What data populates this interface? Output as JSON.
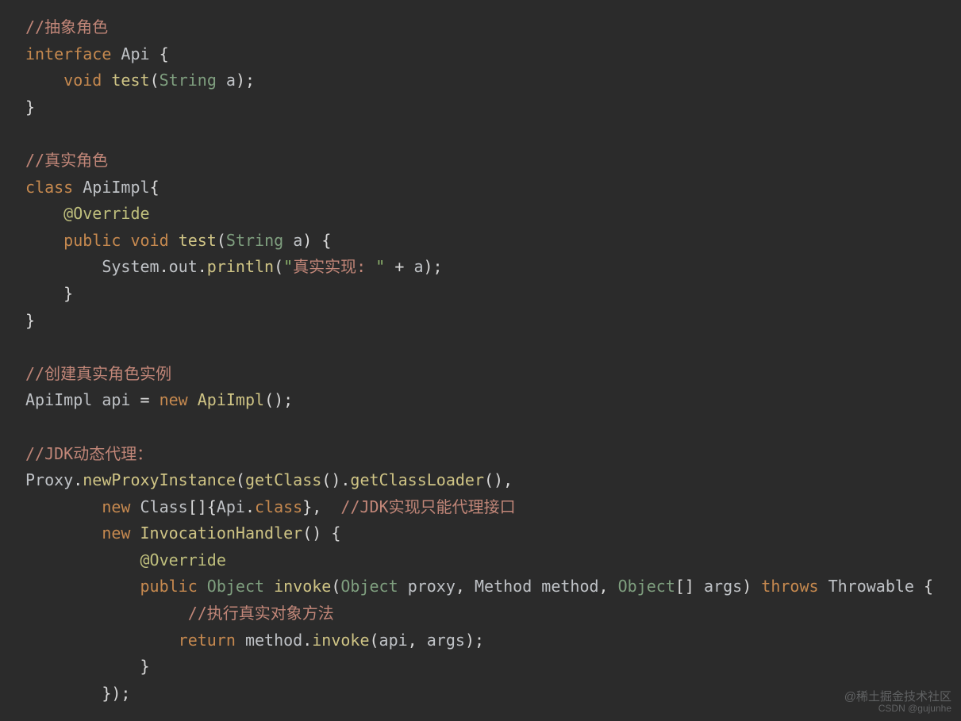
{
  "lines": [
    {
      "id": "l01",
      "tokens": [
        {
          "cls": "c-cn",
          "t": "//抽象角色"
        }
      ]
    },
    {
      "id": "l02",
      "tokens": [
        {
          "cls": "c-keyword",
          "t": "interface"
        },
        {
          "cls": "",
          "t": " "
        },
        {
          "cls": "c-ident",
          "t": "Api "
        },
        {
          "cls": "c-punct",
          "t": "{"
        }
      ]
    },
    {
      "id": "l03",
      "tokens": [
        {
          "cls": "",
          "t": "    "
        },
        {
          "cls": "c-keyword",
          "t": "void"
        },
        {
          "cls": "",
          "t": " "
        },
        {
          "cls": "c-method",
          "t": "test"
        },
        {
          "cls": "c-punct",
          "t": "("
        },
        {
          "cls": "c-type",
          "t": "String"
        },
        {
          "cls": "",
          "t": " "
        },
        {
          "cls": "c-ident",
          "t": "a"
        },
        {
          "cls": "c-punct",
          "t": ");"
        }
      ]
    },
    {
      "id": "l04",
      "tokens": [
        {
          "cls": "c-punct",
          "t": "}"
        }
      ]
    },
    {
      "id": "l05",
      "tokens": [
        {
          "cls": "",
          "t": ""
        }
      ]
    },
    {
      "id": "l06",
      "tokens": [
        {
          "cls": "c-cn",
          "t": "//真实角色"
        }
      ]
    },
    {
      "id": "l07",
      "tokens": [
        {
          "cls": "c-keyword",
          "t": "class"
        },
        {
          "cls": "",
          "t": " "
        },
        {
          "cls": "c-ident",
          "t": "ApiImpl"
        },
        {
          "cls": "c-punct",
          "t": "{"
        }
      ]
    },
    {
      "id": "l08",
      "tokens": [
        {
          "cls": "",
          "t": "    "
        },
        {
          "cls": "c-annot",
          "t": "@Override"
        }
      ]
    },
    {
      "id": "l09",
      "tokens": [
        {
          "cls": "",
          "t": "    "
        },
        {
          "cls": "c-keyword",
          "t": "public"
        },
        {
          "cls": "",
          "t": " "
        },
        {
          "cls": "c-keyword",
          "t": "void"
        },
        {
          "cls": "",
          "t": " "
        },
        {
          "cls": "c-method",
          "t": "test"
        },
        {
          "cls": "c-punct",
          "t": "("
        },
        {
          "cls": "c-type",
          "t": "String"
        },
        {
          "cls": "",
          "t": " "
        },
        {
          "cls": "c-ident",
          "t": "a"
        },
        {
          "cls": "c-punct",
          "t": ") {"
        }
      ]
    },
    {
      "id": "l10",
      "tokens": [
        {
          "cls": "",
          "t": "        "
        },
        {
          "cls": "c-ident",
          "t": "System"
        },
        {
          "cls": "c-punct",
          "t": "."
        },
        {
          "cls": "c-ident",
          "t": "out"
        },
        {
          "cls": "c-punct",
          "t": "."
        },
        {
          "cls": "c-method",
          "t": "println"
        },
        {
          "cls": "c-punct",
          "t": "("
        },
        {
          "cls": "c-string",
          "t": "\""
        },
        {
          "cls": "c-string-cn",
          "t": "真实实现: "
        },
        {
          "cls": "c-string",
          "t": "\""
        },
        {
          "cls": "",
          "t": " "
        },
        {
          "cls": "c-op",
          "t": "+"
        },
        {
          "cls": "",
          "t": " "
        },
        {
          "cls": "c-ident",
          "t": "a"
        },
        {
          "cls": "c-punct",
          "t": ");"
        }
      ]
    },
    {
      "id": "l11",
      "tokens": [
        {
          "cls": "",
          "t": "    "
        },
        {
          "cls": "c-punct",
          "t": "}"
        }
      ]
    },
    {
      "id": "l12",
      "tokens": [
        {
          "cls": "c-punct",
          "t": "}"
        }
      ]
    },
    {
      "id": "l13",
      "tokens": [
        {
          "cls": "",
          "t": ""
        }
      ]
    },
    {
      "id": "l14",
      "tokens": [
        {
          "cls": "c-cn",
          "t": "//创建真实角色实例"
        }
      ]
    },
    {
      "id": "l15",
      "tokens": [
        {
          "cls": "c-ident",
          "t": "ApiImpl api "
        },
        {
          "cls": "c-op",
          "t": "="
        },
        {
          "cls": "",
          "t": " "
        },
        {
          "cls": "c-keyword",
          "t": "new"
        },
        {
          "cls": "",
          "t": " "
        },
        {
          "cls": "c-method",
          "t": "ApiImpl"
        },
        {
          "cls": "c-punct",
          "t": "();"
        }
      ]
    },
    {
      "id": "l16",
      "tokens": [
        {
          "cls": "",
          "t": ""
        }
      ]
    },
    {
      "id": "l17",
      "tokens": [
        {
          "cls": "c-cn",
          "t": "//JDK动态代理："
        }
      ]
    },
    {
      "id": "l18",
      "tokens": [
        {
          "cls": "c-ident",
          "t": "Proxy"
        },
        {
          "cls": "c-punct",
          "t": "."
        },
        {
          "cls": "c-method",
          "t": "newProxyInstance"
        },
        {
          "cls": "c-punct",
          "t": "("
        },
        {
          "cls": "c-method",
          "t": "getClass"
        },
        {
          "cls": "c-punct",
          "t": "()."
        },
        {
          "cls": "c-method",
          "t": "getClassLoader"
        },
        {
          "cls": "c-punct",
          "t": "(),"
        }
      ]
    },
    {
      "id": "l19",
      "tokens": [
        {
          "cls": "",
          "t": "        "
        },
        {
          "cls": "c-keyword",
          "t": "new"
        },
        {
          "cls": "",
          "t": " "
        },
        {
          "cls": "c-ident",
          "t": "Class"
        },
        {
          "cls": "c-punct",
          "t": "[]{"
        },
        {
          "cls": "c-ident",
          "t": "Api"
        },
        {
          "cls": "c-punct",
          "t": "."
        },
        {
          "cls": "c-keyword",
          "t": "class"
        },
        {
          "cls": "c-punct",
          "t": "},  "
        },
        {
          "cls": "c-cn",
          "t": "//JDK实现只能代理接口"
        }
      ]
    },
    {
      "id": "l20",
      "tokens": [
        {
          "cls": "",
          "t": "        "
        },
        {
          "cls": "c-keyword",
          "t": "new"
        },
        {
          "cls": "",
          "t": " "
        },
        {
          "cls": "c-method",
          "t": "InvocationHandler"
        },
        {
          "cls": "c-punct",
          "t": "() {"
        }
      ]
    },
    {
      "id": "l21",
      "tokens": [
        {
          "cls": "",
          "t": "            "
        },
        {
          "cls": "c-annot",
          "t": "@Override"
        }
      ]
    },
    {
      "id": "l22",
      "tokens": [
        {
          "cls": "",
          "t": "            "
        },
        {
          "cls": "c-keyword",
          "t": "public"
        },
        {
          "cls": "",
          "t": " "
        },
        {
          "cls": "c-type",
          "t": "Object"
        },
        {
          "cls": "",
          "t": " "
        },
        {
          "cls": "c-method",
          "t": "invoke"
        },
        {
          "cls": "c-punct",
          "t": "("
        },
        {
          "cls": "c-type",
          "t": "Object"
        },
        {
          "cls": "",
          "t": " "
        },
        {
          "cls": "c-ident",
          "t": "proxy"
        },
        {
          "cls": "c-punct",
          "t": ", "
        },
        {
          "cls": "c-ident",
          "t": "Method method"
        },
        {
          "cls": "c-punct",
          "t": ", "
        },
        {
          "cls": "c-type",
          "t": "Object"
        },
        {
          "cls": "c-punct",
          "t": "[] "
        },
        {
          "cls": "c-ident",
          "t": "args"
        },
        {
          "cls": "c-punct",
          "t": ") "
        },
        {
          "cls": "c-keyword",
          "t": "throws"
        },
        {
          "cls": "",
          "t": " "
        },
        {
          "cls": "c-ident",
          "t": "Throwable "
        },
        {
          "cls": "c-punct",
          "t": "{"
        }
      ]
    },
    {
      "id": "l23",
      "tokens": [
        {
          "cls": "",
          "t": "                 "
        },
        {
          "cls": "c-cn",
          "t": "//执行真实对象方法"
        }
      ]
    },
    {
      "id": "l24",
      "tokens": [
        {
          "cls": "",
          "t": "                "
        },
        {
          "cls": "c-keyword",
          "t": "return"
        },
        {
          "cls": "",
          "t": " "
        },
        {
          "cls": "c-ident",
          "t": "method"
        },
        {
          "cls": "c-punct",
          "t": "."
        },
        {
          "cls": "c-method",
          "t": "invoke"
        },
        {
          "cls": "c-punct",
          "t": "("
        },
        {
          "cls": "c-ident",
          "t": "api"
        },
        {
          "cls": "c-punct",
          "t": ", "
        },
        {
          "cls": "c-ident",
          "t": "args"
        },
        {
          "cls": "c-punct",
          "t": ");"
        }
      ]
    },
    {
      "id": "l25",
      "tokens": [
        {
          "cls": "",
          "t": "            "
        },
        {
          "cls": "c-punct",
          "t": "}"
        }
      ]
    },
    {
      "id": "l26",
      "tokens": [
        {
          "cls": "",
          "t": "        "
        },
        {
          "cls": "c-punct",
          "t": "});"
        }
      ]
    }
  ],
  "watermark": {
    "line1": "@稀土掘金技术社区",
    "line2": "CSDN @gujunhe"
  }
}
